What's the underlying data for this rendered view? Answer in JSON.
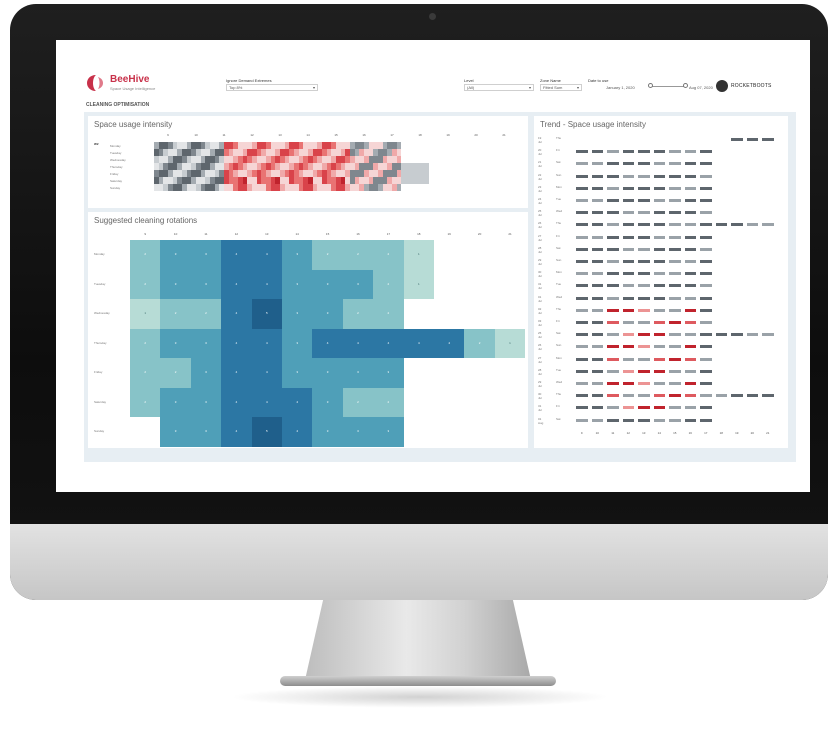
{
  "header": {
    "logo_name": "BeeHive",
    "logo_sub": "Space Usage Intelligence",
    "filter1_label": "Ignore Demand Extremes",
    "filter1_value": "Top 8%",
    "filter2_label": "Level",
    "filter2_value": "(All)",
    "filter3_label": "Zone Name",
    "filter3_value": "Fitted Sum",
    "filter4_label": "Date to use",
    "date_start": "January 1, 2020",
    "date_end": "Aug 07, 2020",
    "brand": "ROCKETBOOTS"
  },
  "page_title": "CLEANING OPTIMISATION",
  "colors": {
    "accent": "#c8314a",
    "teal_light": "#b7dcd6",
    "teal_dark": "#1f5f8b",
    "heat_red": "#c0232d",
    "heat_gray": "#6b737b"
  },
  "usage": {
    "title": "Space usage intensity",
    "group_label": "W2",
    "hours": [
      "9",
      "10",
      "11",
      "12",
      "13",
      "14",
      "15",
      "16",
      "17",
      "18",
      "19",
      "20",
      "21"
    ],
    "days": [
      "Monday",
      "Tuesday",
      "Wednesday",
      "Thursday",
      "Friday",
      "Saturday",
      "Sunday"
    ]
  },
  "rotations": {
    "title": "Suggested cleaning rotations",
    "hours": [
      "9",
      "10",
      "11",
      "12",
      "13",
      "14",
      "15",
      "16",
      "17",
      "18",
      "19",
      "20",
      "21"
    ],
    "days": [
      "Monday",
      "Tuesday",
      "Wednesday",
      "Thursday",
      "Friday",
      "Saturday",
      "Sunday"
    ],
    "values": [
      [
        2,
        3,
        3,
        4,
        4,
        3,
        2,
        2,
        2,
        1,
        null,
        null,
        null
      ],
      [
        2,
        3,
        3,
        4,
        4,
        3,
        3,
        3,
        2,
        1,
        null,
        null,
        null
      ],
      [
        1,
        2,
        2,
        4,
        5,
        3,
        3,
        2,
        2,
        null,
        null,
        null,
        null
      ],
      [
        2,
        3,
        3,
        4,
        4,
        3,
        4,
        4,
        4,
        4,
        4,
        2,
        1
      ],
      [
        2,
        2,
        3,
        4,
        4,
        3,
        3,
        3,
        3,
        null,
        null,
        null,
        null
      ],
      [
        2,
        3,
        3,
        4,
        4,
        4,
        3,
        2,
        2,
        null,
        null,
        null,
        null
      ],
      [
        null,
        3,
        3,
        4,
        5,
        4,
        3,
        3,
        3,
        null,
        null,
        null,
        null
      ]
    ]
  },
  "trend": {
    "title": "Trend - Space usage intensity",
    "rows": [
      {
        "date": "19 Jul",
        "day": "Thu"
      },
      {
        "date": "20 Jul",
        "day": "Fri"
      },
      {
        "date": "21 Jul",
        "day": "Sat"
      },
      {
        "date": "22 Jul",
        "day": "Sun"
      },
      {
        "date": "23 Jul",
        "day": "Mon"
      },
      {
        "date": "24 Jul",
        "day": "Tue"
      },
      {
        "date": "25 Jul",
        "day": "Wed"
      },
      {
        "date": "26 Jul",
        "day": "Thu"
      },
      {
        "date": "27 Jul",
        "day": "Fri"
      },
      {
        "date": "28 Jul",
        "day": "Sat"
      },
      {
        "date": "29 Jul",
        "day": "Sun"
      },
      {
        "date": "30 Jul",
        "day": "Mon"
      },
      {
        "date": "31 Jul",
        "day": "Tue"
      },
      {
        "date": "01 Jul",
        "day": "Wed"
      },
      {
        "date": "02 Jul",
        "day": "Thu"
      },
      {
        "date": "03 Jul",
        "day": "Fri"
      },
      {
        "date": "25 Jul",
        "day": "Sat"
      },
      {
        "date": "26 Jul",
        "day": "Sun"
      },
      {
        "date": "27 Jul",
        "day": "Mon"
      },
      {
        "date": "28 Jul",
        "day": "Tue"
      },
      {
        "date": "29 Jul",
        "day": "Wed"
      },
      {
        "date": "30 Jul",
        "day": "Thu"
      },
      {
        "date": "31 Jul",
        "day": "Fri"
      },
      {
        "date": "01 Aug",
        "day": "Sat"
      }
    ],
    "hours": [
      "9",
      "10",
      "11",
      "12",
      "13",
      "14",
      "15",
      "16",
      "17",
      "18",
      "19",
      "20",
      "21"
    ]
  }
}
